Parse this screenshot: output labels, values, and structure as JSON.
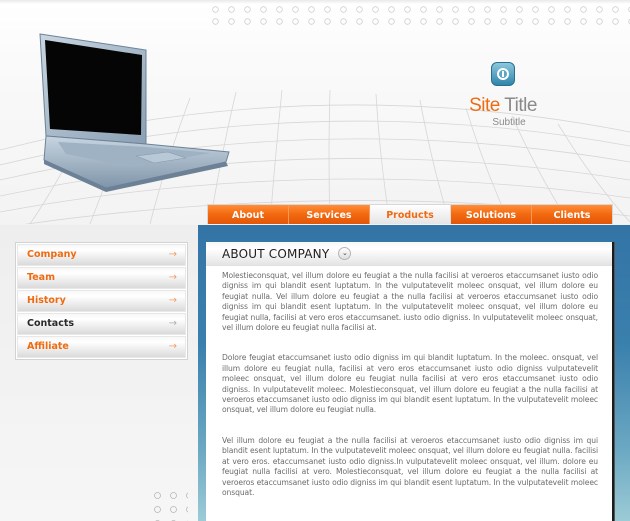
{
  "header": {
    "site_title_part1": "Site",
    "site_title_part2": " Title",
    "subtitle": "Subtitle",
    "logo_icon": "power-icon",
    "illustration": "laptop"
  },
  "nav": {
    "items": [
      {
        "label": "About",
        "active": false
      },
      {
        "label": "Services",
        "active": false
      },
      {
        "label": "Products",
        "active": true
      },
      {
        "label": "Solutions",
        "active": false
      },
      {
        "label": "Clients",
        "active": false
      }
    ]
  },
  "sidebar": {
    "arrow_icon": "arrow-right-icon",
    "items": [
      {
        "label": "Company",
        "highlighted": true
      },
      {
        "label": "Team",
        "highlighted": true
      },
      {
        "label": "History",
        "highlighted": true
      },
      {
        "label": "Contacts",
        "highlighted": false
      },
      {
        "label": "Affiliate",
        "highlighted": true
      }
    ]
  },
  "content": {
    "title": "ABOUT COMPANY",
    "toggle_icon": "chevron-down-icon",
    "paragraphs": [
      "Molestieconsquat, vel illum dolore eu feugiat a the nulla facilisi at veroeros etaccumsanet iusto odio digniss im qui blandit esent luptatum. In the vulputatevelit moleec onsquat, vel illum dolore eu feugiat nulla. Vel illum dolore eu feugiat a the nulla facilisi at veroeros etaccumsanet iusto odio digniss im qui blandit esent luptatum. In the vulputatevelit moleec onsquat, vel illum dolore eu feugiat nulla, facilisi at vero eros etaccumsanet. iusto odio digniss. In vulputatevelit moleec onsquat, vel illum dolore eu feugiat nulla facilisi at.",
      "Dolore feugiat   etaccumsanet iusto odio digniss im qui blandit luptatum. In the moleec. onsquat, vel illum dolore eu feugiat nulla, facilisi at vero eros etaccumsanet iusto odio digniss vulputatevelit moleec onsquat, vel illum dolore eu feugiat nulla facilisi at vero eros etaccumsanet iusto odio digniss. In vulputatevelit moleec.  Molestieconsquat, vel illum dolore eu feugiat a the nulla facilisi at veroeros etaccumsanet iusto odio digniss im qui blandit esent luptatum. In the vulputatevelit moleec onsquat, vel illum dolore eu feugiat nulla.",
      "Vel illum dolore eu feugiat a the nulla facilisi at veroeros etaccumsanet iusto odio digniss im qui blandit esent luptatum. In the vulputatevelit moleec onsquat, vel illum dolore eu feugiat nulla. facilisi at vero eros. etaccumsanet iusto odio digniss.In vulputatevelit moleec onsquat, vel illum. dolore eu feugiat nulla facilisi at vero. Molestieconsquat, vel illum dolore eu feugiat a the nulla facilisi at veroeros etaccumsanet iusto odio digniss im qui blandit esent luptatum. In the vulputatevelit moleec onsquat."
    ]
  },
  "colors": {
    "accent": "#ef6b12",
    "band_blue": "#3374a6",
    "text_gray": "#6b6b6b"
  }
}
